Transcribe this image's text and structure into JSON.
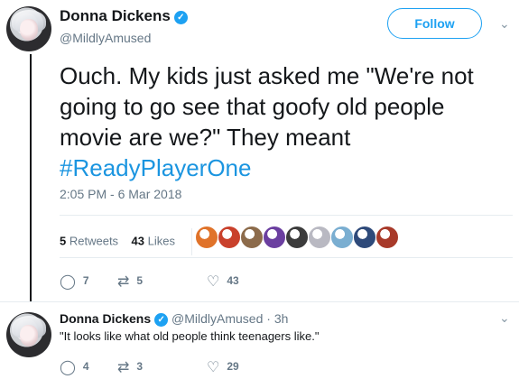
{
  "tweet": {
    "author_name": "Donna Dickens",
    "author_handle": "@MildlyAmused",
    "follow_label": "Follow",
    "text_main": "Ouch. My kids just asked me \"We're not going to go see that goofy old people movie are we?\" They meant",
    "hashtag": "#ReadyPlayerOne",
    "timestamp": "2:05 PM - 6 Mar 2018",
    "retweets_count": "5",
    "retweets_label": "Retweets",
    "likes_count": "43",
    "likes_label": "Likes",
    "liker_colors": [
      "#e0732a",
      "#c9412c",
      "#8c6b4b",
      "#6b3fa0",
      "#3c3c3c",
      "#b9b9c2",
      "#7aaed1",
      "#2e4a7a",
      "#a83a2a"
    ],
    "actions": {
      "replies": "7",
      "retweets": "5",
      "likes": "43"
    }
  },
  "reply": {
    "author_name": "Donna Dickens",
    "author_handle": "@MildlyAmused",
    "separator": "·",
    "time": "3h",
    "text": "\"It looks like what old people think teenagers like.\"",
    "actions": {
      "replies": "4",
      "retweets": "3",
      "likes": "29"
    }
  },
  "colors": {
    "accent": "#1da1f2",
    "hashtag": "#1b95e0",
    "muted": "#657786"
  },
  "icons": {
    "verified": "verified-badge-icon",
    "chevron": "chevron-down-icon",
    "reply": "reply-icon",
    "retweet": "retweet-icon",
    "like": "heart-icon"
  }
}
